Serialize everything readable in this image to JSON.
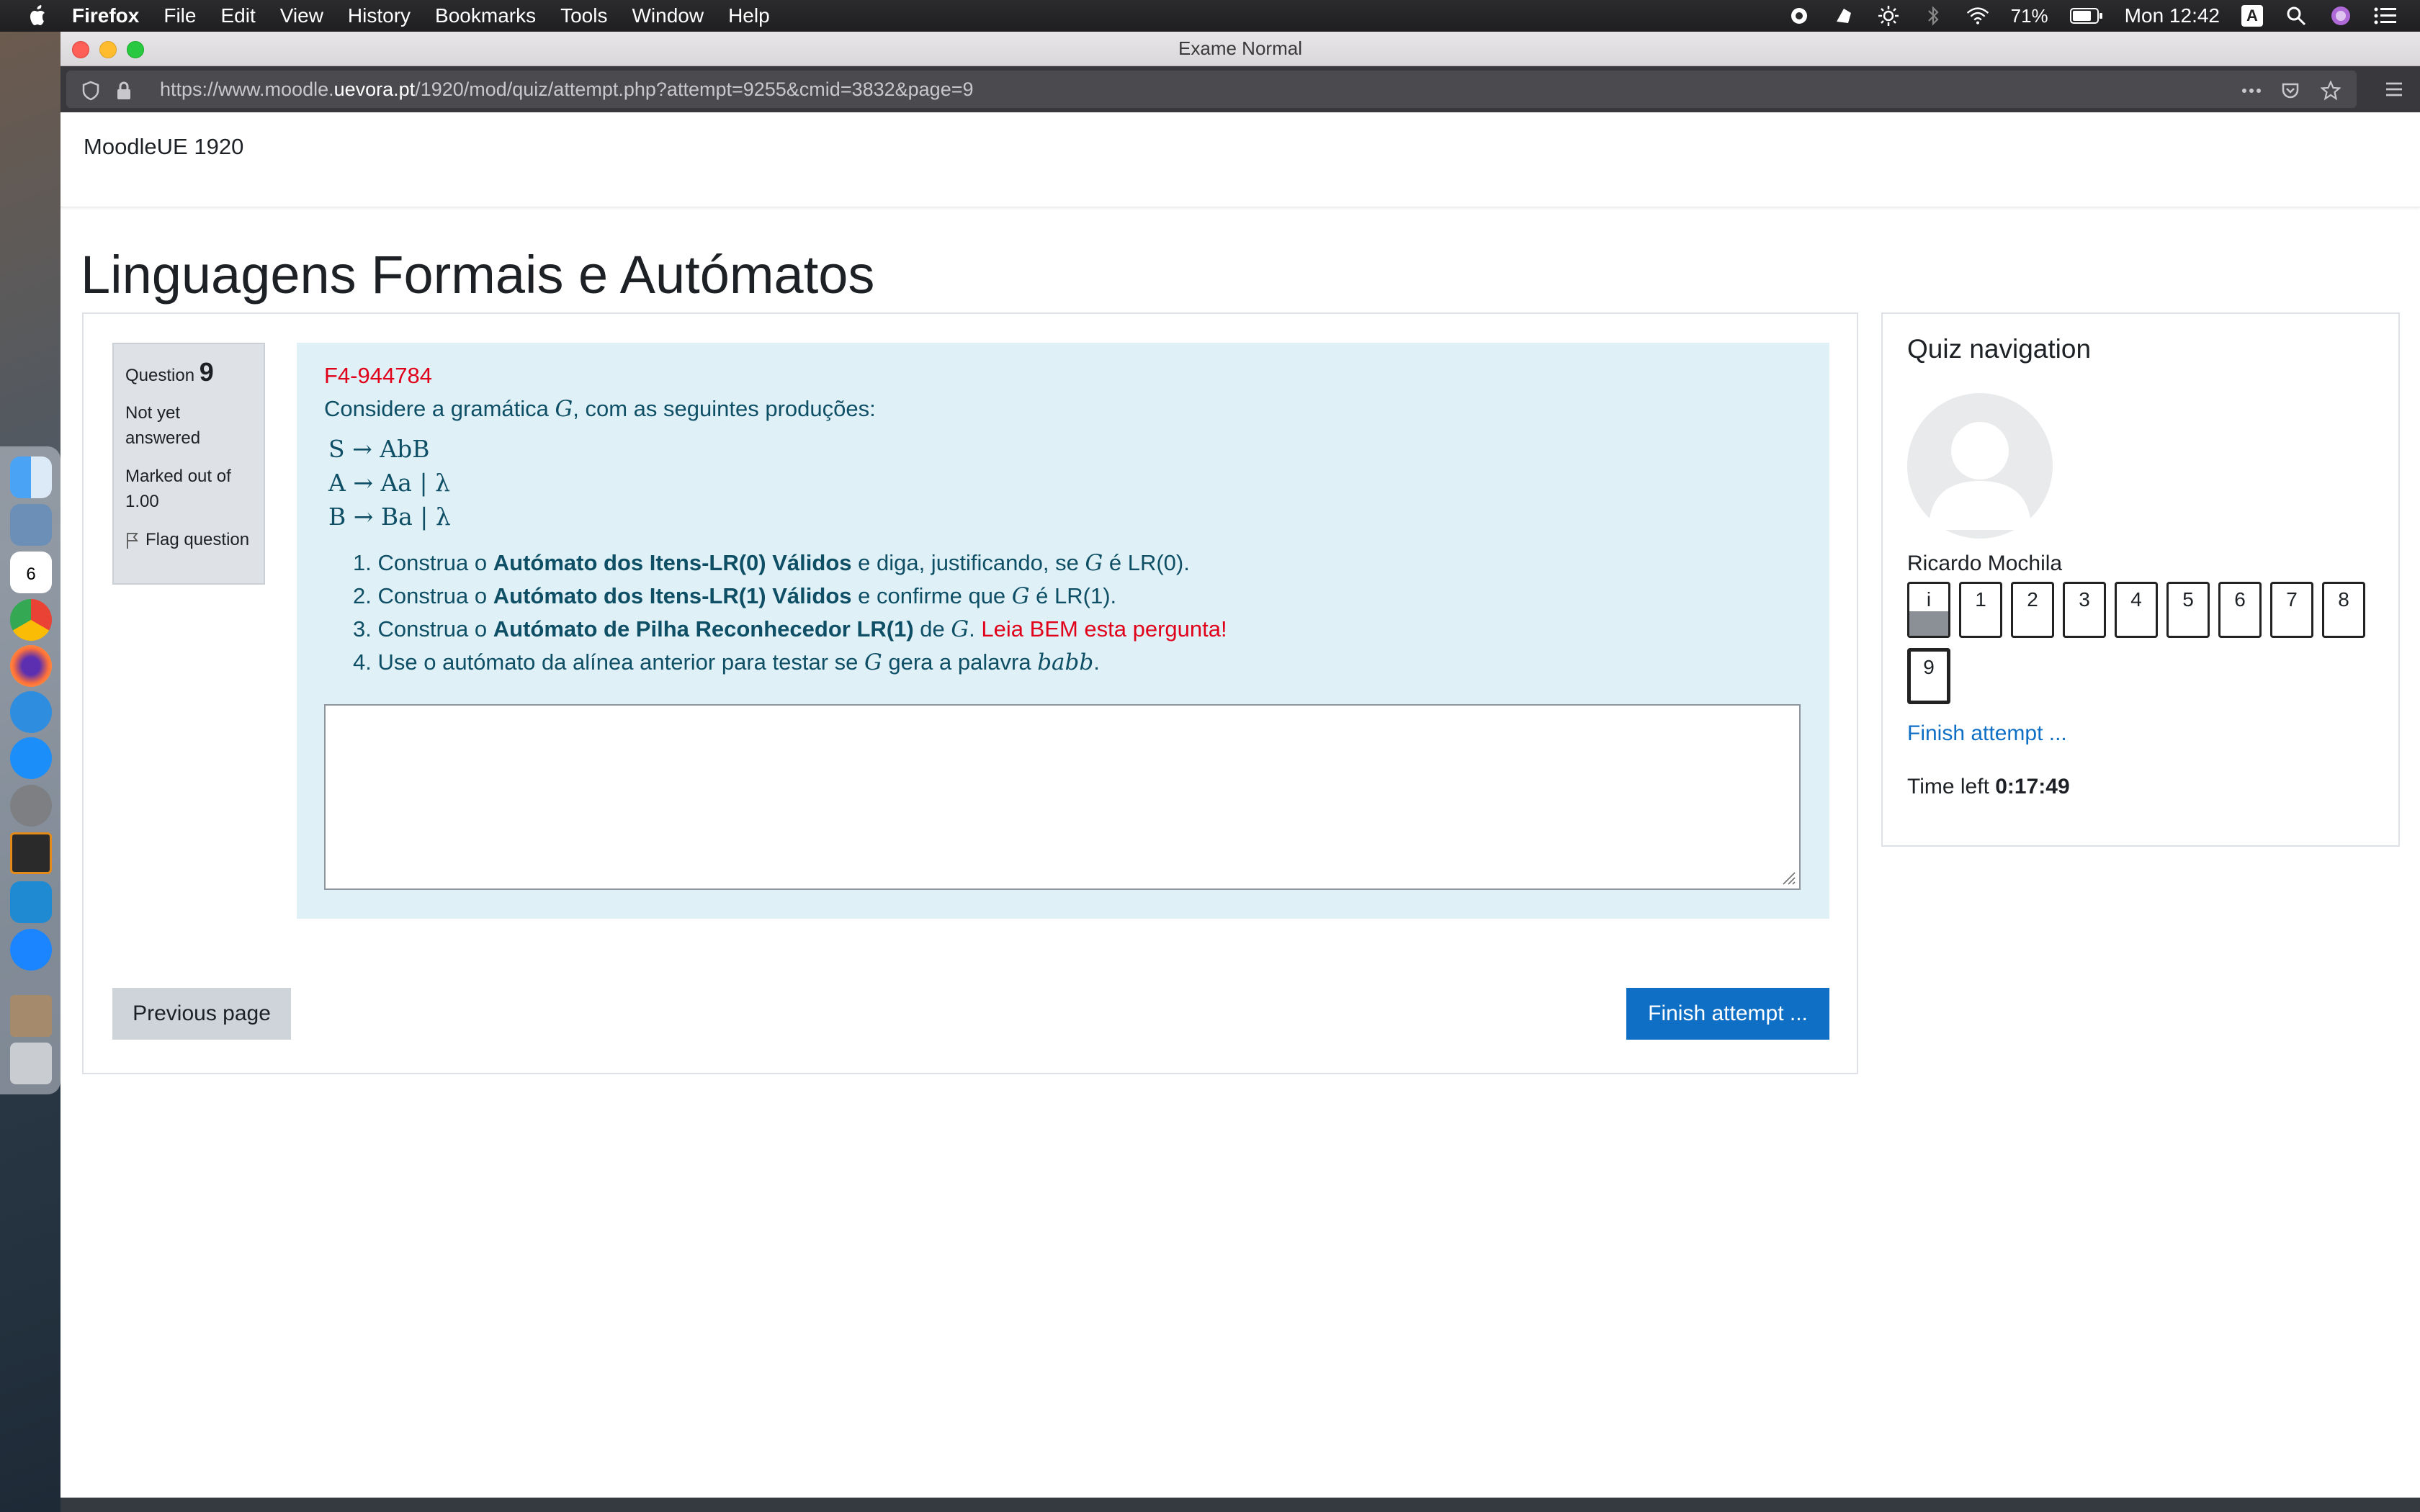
{
  "menubar": {
    "app": "Firefox",
    "items": [
      "File",
      "Edit",
      "View",
      "History",
      "Bookmarks",
      "Tools",
      "Window",
      "Help"
    ],
    "battery": "71%",
    "clock": "Mon 12:42",
    "input_source": "A"
  },
  "window": {
    "title": "Exame Normal",
    "url_prefix": "https://www.moodle.",
    "url_host": "uevora.pt",
    "url_path": "/1920/mod/quiz/attempt.php?attempt=9255&cmid=3832&page=9"
  },
  "site": {
    "name": "MoodleUE 1920"
  },
  "course": {
    "title": "Linguagens Formais e Autómatos"
  },
  "question": {
    "label": "Question",
    "number": "9",
    "state": "Not yet answered",
    "mark": "Marked out of 1.00",
    "flag": "Flag question",
    "code": "F4-944784",
    "intro_before": "Considere a gramática ",
    "grammar_symbol": "G",
    "intro_after": ", com as seguintes produções:",
    "productions": [
      "S → AbB",
      "A → Aa | λ",
      "B → Ba | λ"
    ],
    "items": [
      {
        "n": "1.",
        "a": "Construa o ",
        "b": "Autómato dos Itens-LR(0) Válidos",
        "c": " e diga, justificando, se ",
        "g": "G",
        "d": " é LR(0).",
        "e": ""
      },
      {
        "n": "2.",
        "a": "Construa o ",
        "b": "Autómato dos Itens-LR(1) Válidos",
        "c": " e confirme que ",
        "g": "G",
        "d": " é LR(1).",
        "e": ""
      },
      {
        "n": "3.",
        "a": "Construa o ",
        "b": "Autómato de Pilha Reconhecedor LR(1)",
        "c": " de ",
        "g": "G",
        "d": ". ",
        "e": "Leia BEM esta pergunta!"
      },
      {
        "n": "4.",
        "a": "Use o autómato da alínea anterior para testar se ",
        "b": "",
        "c": "",
        "g": "G",
        "d": " gera a palavra ",
        "e": "babb"
      }
    ],
    "answer_value": ""
  },
  "buttons": {
    "previous": "Previous page",
    "finish": "Finish attempt ..."
  },
  "quiz_nav": {
    "title": "Quiz navigation",
    "user": "Ricardo Mochila",
    "pages": [
      "i",
      "1",
      "2",
      "3",
      "4",
      "5",
      "6",
      "7",
      "8",
      "9"
    ],
    "finish_link": "Finish attempt ...",
    "time_label": "Time left ",
    "time_value": "0:17:49"
  }
}
